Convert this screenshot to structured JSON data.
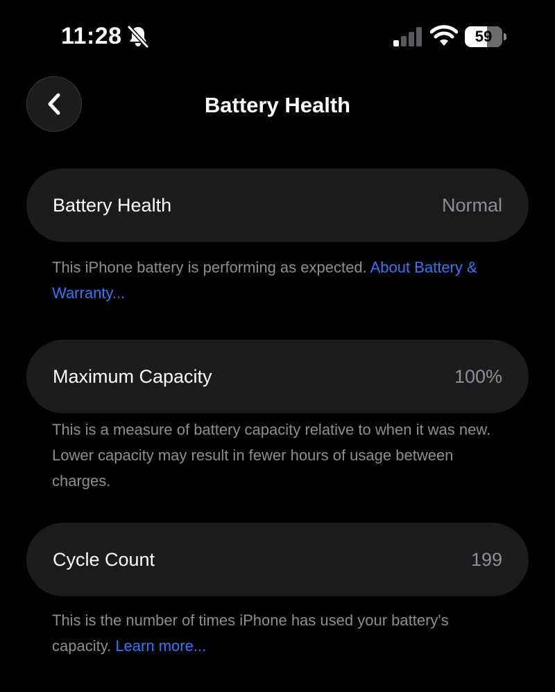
{
  "status_bar": {
    "time": "11:28",
    "battery_percent": "59",
    "battery_level": 0.59,
    "silent_icon": "bell-slash-icon",
    "signal_icon": "cellular-signal-icon",
    "wifi_icon": "wifi-icon"
  },
  "nav": {
    "back_icon": "chevron-left-icon",
    "title": "Battery Health"
  },
  "sections": [
    {
      "label": "Battery Health",
      "value": "Normal",
      "footnote_text": "This iPhone battery is performing as expected. ",
      "footnote_link": "About Battery & Warranty..."
    },
    {
      "label": "Maximum Capacity",
      "value": "100%",
      "footnote_text": "This is a measure of battery capacity relative to when it was new. Lower capacity may result in fewer hours of usage between charges.",
      "footnote_link": ""
    },
    {
      "label": "Cycle Count",
      "value": "199",
      "footnote_text": "This is the number of times iPhone has used your battery's capacity. ",
      "footnote_link": "Learn more..."
    }
  ],
  "colors": {
    "background": "#000000",
    "card": "#1c1c1e",
    "secondary_text": "#8e8e93",
    "link": "#3478f6"
  }
}
